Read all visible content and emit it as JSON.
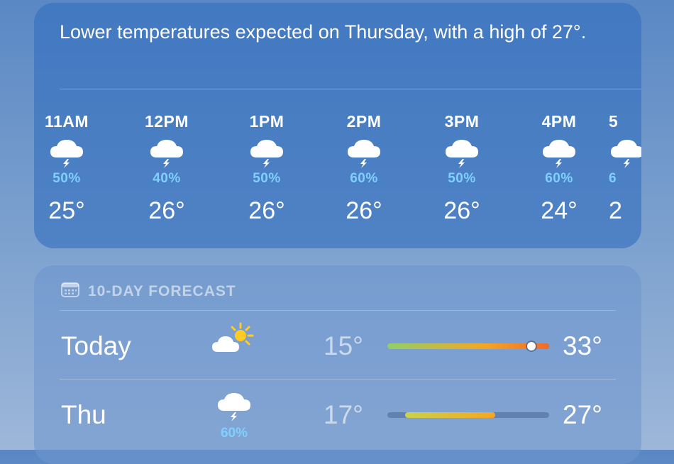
{
  "hourly": {
    "summary": "Lower temperatures expected on Thursday, with a high of 27°.",
    "items": [
      {
        "time": "11AM",
        "icon": "thunderstorm-icon",
        "pop": "50%",
        "temp": "25°"
      },
      {
        "time": "12PM",
        "icon": "thunderstorm-icon",
        "pop": "40%",
        "temp": "26°"
      },
      {
        "time": "1PM",
        "icon": "thunderstorm-icon",
        "pop": "50%",
        "temp": "26°"
      },
      {
        "time": "2PM",
        "icon": "thunderstorm-icon",
        "pop": "60%",
        "temp": "26°"
      },
      {
        "time": "3PM",
        "icon": "thunderstorm-icon",
        "pop": "50%",
        "temp": "26°"
      },
      {
        "time": "4PM",
        "icon": "thunderstorm-icon",
        "pop": "60%",
        "temp": "24°"
      },
      {
        "time": "5",
        "icon": "thunderstorm-icon",
        "pop": "6",
        "temp": "2"
      }
    ]
  },
  "forecast": {
    "header": "10-DAY FORECAST",
    "header_icon": "calendar-icon",
    "range_min": 15,
    "range_max": 33,
    "days": [
      {
        "name": "Today",
        "icon": "partly-sunny-icon",
        "pop": "",
        "low": "15°",
        "high": "33°",
        "low_value": 15,
        "high_value": 33,
        "current_value": 31
      },
      {
        "name": "Thu",
        "icon": "thunderstorm-icon",
        "pop": "60%",
        "low": "17°",
        "high": "27°",
        "low_value": 17,
        "high_value": 27
      }
    ]
  },
  "colors": {
    "precip": "#7fd0ff",
    "bar_cool": "#8fd06a",
    "bar_warm": "#f5a623",
    "bar_hot": "#f06a2a"
  }
}
